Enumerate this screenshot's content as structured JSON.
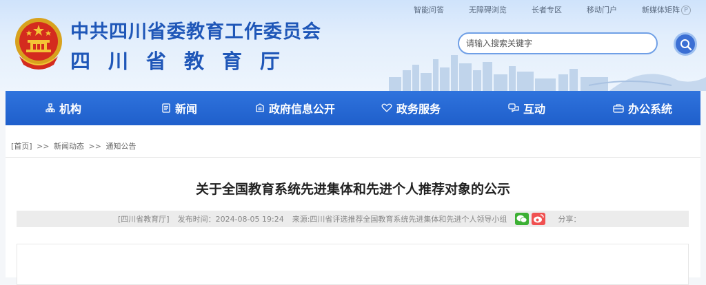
{
  "header": {
    "title": "中共四川省委教育工作委员会",
    "subtitle": "四川省教育厅",
    "top_links": [
      "智能问答",
      "无障碍浏览",
      "长者专区",
      "移动门户",
      "新媒体矩阵"
    ],
    "search": {
      "placeholder": "请输入搜索关键字"
    }
  },
  "nav": {
    "items": [
      {
        "label": "机构",
        "icon": "org-icon"
      },
      {
        "label": "新闻",
        "icon": "news-icon"
      },
      {
        "label": "政府信息公开",
        "icon": "info-disclosure-icon"
      },
      {
        "label": "政务服务",
        "icon": "service-icon"
      },
      {
        "label": "互动",
        "icon": "interaction-icon"
      },
      {
        "label": "办公系统",
        "icon": "office-icon"
      }
    ]
  },
  "breadcrumb": {
    "home": "[首页]",
    "sep": ">>",
    "items": [
      "新闻动态",
      "通知公告"
    ]
  },
  "article": {
    "title": "关于全国教育系统先进集体和先进个人推荐对象的公示",
    "meta": {
      "org": "[四川省教育厅]",
      "published": "发布时间：2024-08-05 19:24",
      "source": "来源:四川省评选推荐全国教育系统先进集体和先进个人领导小组",
      "share_label": "分享："
    }
  },
  "colors": {
    "brand_blue": "#1f57b8",
    "nav_blue": "#2468d3",
    "wechat": "#3cb034",
    "weibo": "#f05050"
  }
}
